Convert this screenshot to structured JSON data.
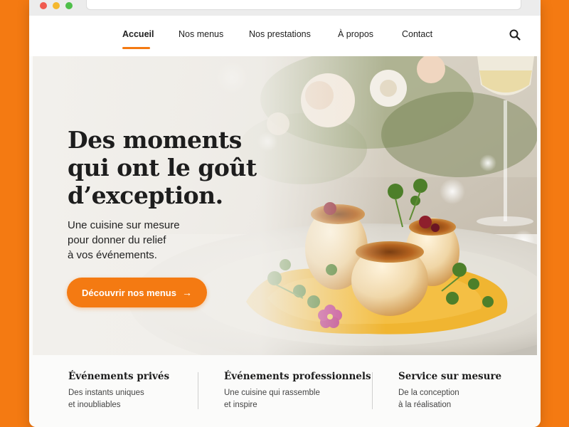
{
  "window": {
    "controls": [
      "close",
      "minimize",
      "maximize"
    ]
  },
  "nav": {
    "items": [
      {
        "label": "Accueil",
        "active": true
      },
      {
        "label": "Nos menus",
        "active": false
      },
      {
        "label": "Nos prestations",
        "active": false
      },
      {
        "label": "À propos",
        "active": false
      },
      {
        "label": "Contact",
        "active": false
      }
    ],
    "search_icon": "search-icon"
  },
  "hero": {
    "title_lines": [
      "Des moments",
      "qui ont le goût",
      "d’exception."
    ],
    "subtitle_lines": [
      "Une cuisine sur mesure",
      "pour donner du relief",
      "à vos événements."
    ],
    "cta_label": "Découvrir nos menus",
    "cta_icon": "arrow-right-icon",
    "image": "plated-scallops-dish-with-flowers"
  },
  "features": [
    {
      "title": "Événements privés",
      "desc_lines": [
        "Des instants uniques",
        "et inoubliables"
      ]
    },
    {
      "title": "Événements professionnels",
      "desc_lines": [
        "Une cuisine qui rassemble",
        "et inspire"
      ]
    },
    {
      "title": "Service sur mesure",
      "desc_lines": [
        "De la conception",
        "à la réalisation"
      ]
    }
  ],
  "colors": {
    "accent": "#f47a12",
    "background": "#f47a12",
    "text": "#1d1d1d"
  }
}
